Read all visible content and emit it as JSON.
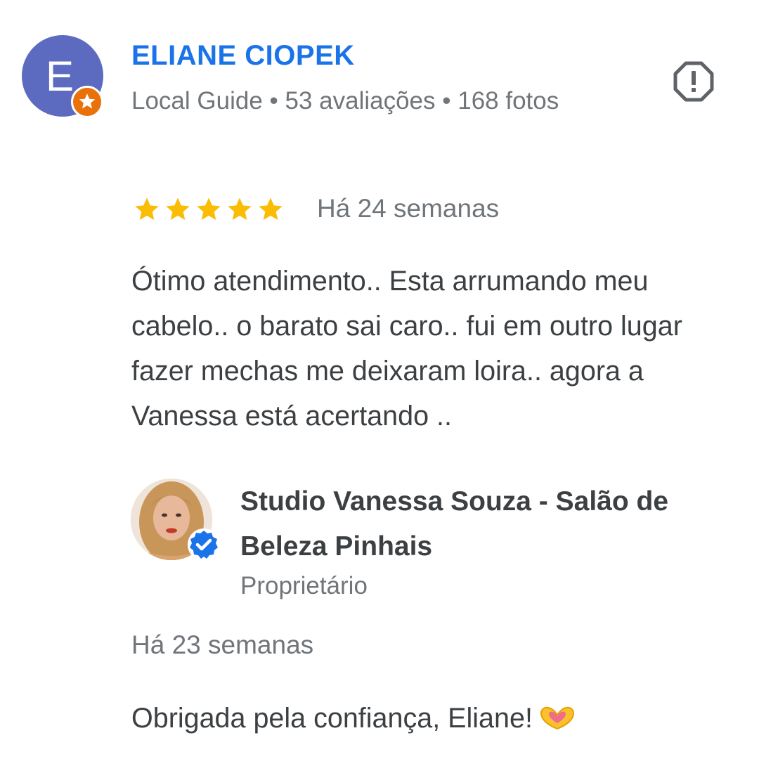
{
  "reviewer": {
    "initial": "E",
    "name": "ELIANE CIOPEK",
    "meta": "Local Guide • 53 avaliações • 168 fotos",
    "avatar_color": "#5c6bc0",
    "badge_icon": "local-guide-star-icon",
    "badge_color": "#e8710a"
  },
  "report_icon": "report-icon",
  "review": {
    "rating": 5,
    "max_rating": 5,
    "star_color": "#fbbc04",
    "time": "Há 24 semanas",
    "text": "Ótimo atendimento.. Esta arrumando meu cabelo.. o barato sai caro.. fui em outro lugar fazer mechas me deixaram loira.. agora a Vanessa está acertando .."
  },
  "owner_reply": {
    "name": "Studio Vanessa Souza - Salão de Beleza Pinhais",
    "role": "Proprietário",
    "verified_icon": "verified-check-icon",
    "verified_color": "#1a73e8",
    "time": "Há 23 semanas",
    "text": "Obrigada pela confiança, Eliane!",
    "emoji_icon": "heart-hands-icon"
  }
}
